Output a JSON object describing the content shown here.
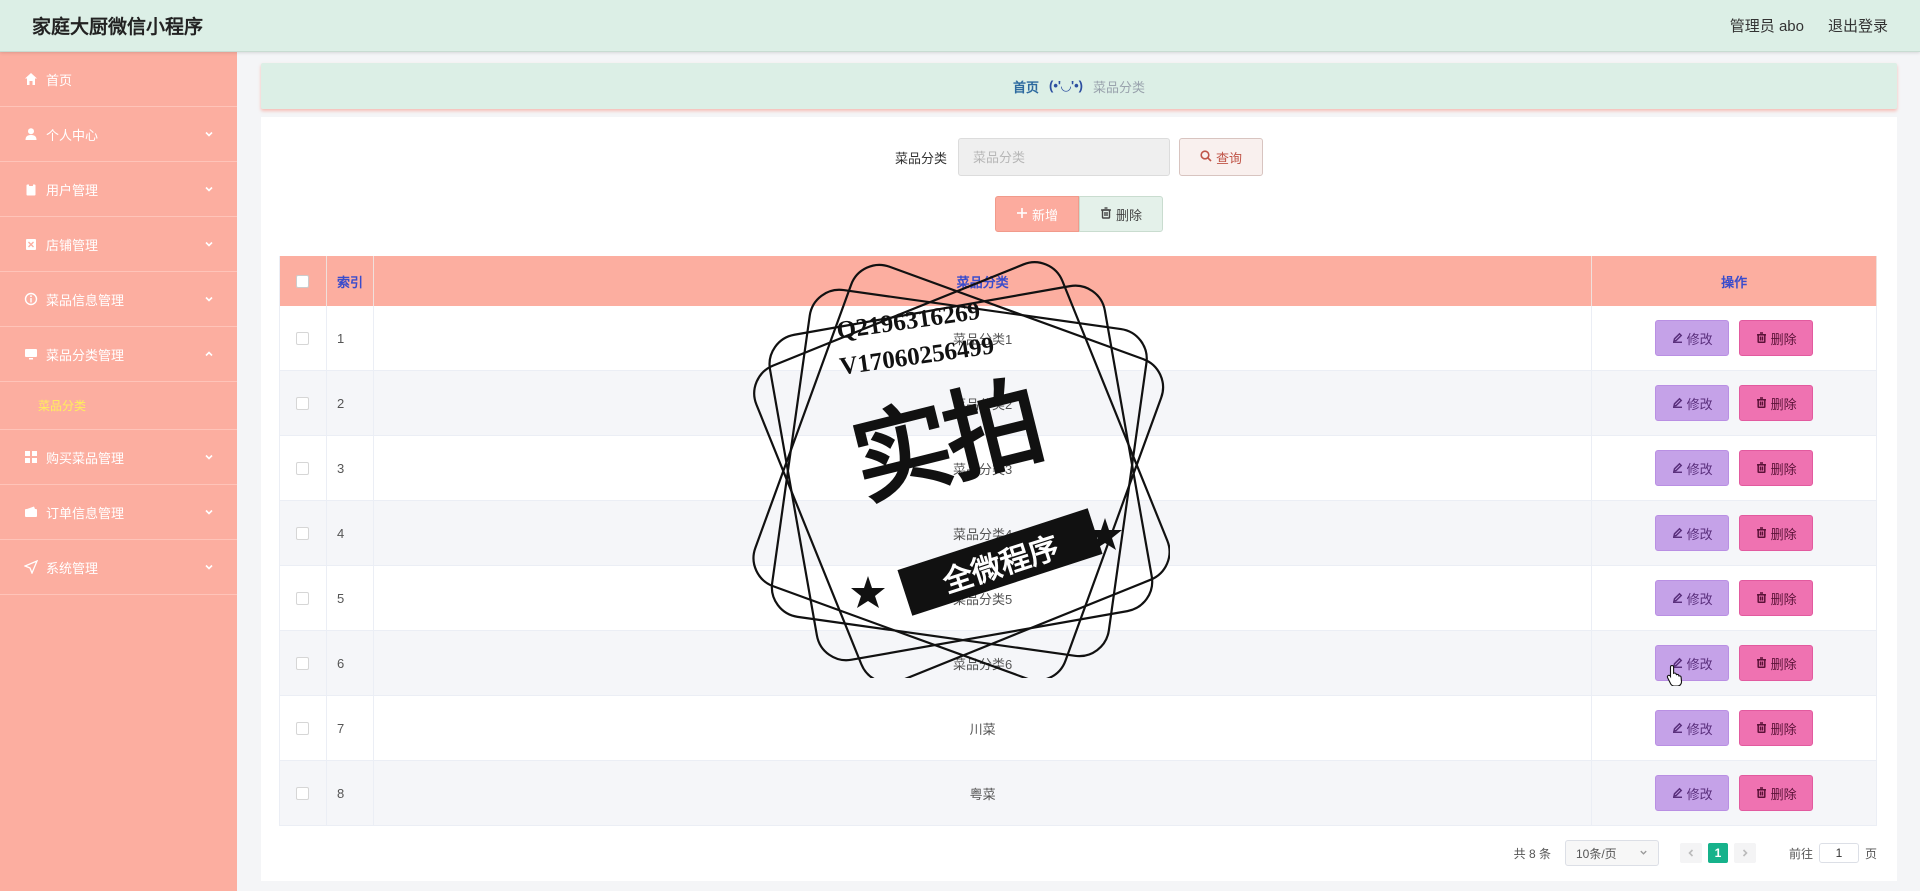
{
  "header": {
    "app_title": "家庭大厨微信小程序",
    "user_label": "管理员 abo",
    "logout_label": "退出登录"
  },
  "sidebar": {
    "items": [
      {
        "label": "首页",
        "icon": "home-icon"
      },
      {
        "label": "个人中心",
        "icon": "user-icon"
      },
      {
        "label": "用户管理",
        "icon": "clipboard-icon"
      },
      {
        "label": "店铺管理",
        "icon": "store-icon"
      },
      {
        "label": "菜品信息管理",
        "icon": "info-icon"
      },
      {
        "label": "菜品分类管理",
        "icon": "monitor-icon",
        "expanded": true
      },
      {
        "label": "购买菜品管理",
        "icon": "grid-icon"
      },
      {
        "label": "订单信息管理",
        "icon": "wallet-icon"
      },
      {
        "label": "系统管理",
        "icon": "send-icon"
      }
    ],
    "active_sub": "菜品分类"
  },
  "breadcrumb": {
    "home": "首页",
    "emote": "(•'◡'•)",
    "current": "菜品分类"
  },
  "search": {
    "label": "菜品分类",
    "placeholder": "菜品分类",
    "query_label": "查询"
  },
  "actions": {
    "add_label": "新增",
    "delete_label": "删除"
  },
  "table": {
    "headers": {
      "index": "索引",
      "name": "菜品分类",
      "op": "操作"
    },
    "edit_label": "修改",
    "remove_label": "删除",
    "rows": [
      {
        "index": "1",
        "name": "菜品分类1"
      },
      {
        "index": "2",
        "name": "菜品分类2"
      },
      {
        "index": "3",
        "name": "菜品分类3"
      },
      {
        "index": "4",
        "name": "菜品分类4"
      },
      {
        "index": "5",
        "name": "菜品分类5"
      },
      {
        "index": "6",
        "name": "菜品分类6"
      },
      {
        "index": "7",
        "name": "川菜"
      },
      {
        "index": "8",
        "name": "粤菜"
      }
    ]
  },
  "pagination": {
    "total": "共 8 条",
    "page_size": "10条/页",
    "current_page": "1",
    "goto_prefix": "前往",
    "goto_value": "1",
    "goto_suffix": "页"
  },
  "watermark": {
    "line1": "Q2196316269",
    "line2": "V17060256499",
    "big": "实拍",
    "ribbon": "全微程序"
  },
  "colors": {
    "topbar": "#dcefe6",
    "sidebar": "#fcaea0",
    "submenu_active": "#ffef5c",
    "table_header": "#fcaea0",
    "edit_button": "#c5a2e8",
    "remove_button": "#ef72b1",
    "pager_active": "#16b28b"
  }
}
